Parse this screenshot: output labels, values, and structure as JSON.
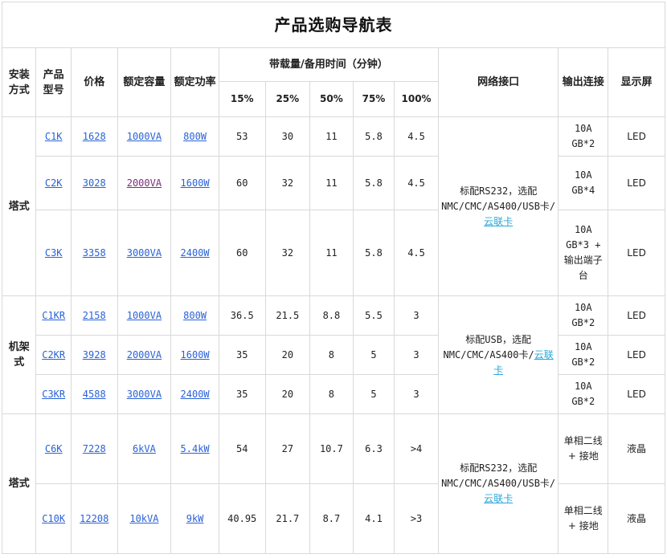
{
  "title": "产品选购导航表",
  "headers": {
    "install": "安装方式",
    "model": "产品型号",
    "price": "价格",
    "capacity": "额定容量",
    "power": "额定功率",
    "backup": "带载量/备用时间（分钟）",
    "p15": "15%",
    "p25": "25%",
    "p50": "50%",
    "p75": "75%",
    "p100": "100%",
    "network": "网络接口",
    "output": "输出连接",
    "display": "显示屏"
  },
  "groups": [
    {
      "install": "塔式",
      "network_prefix": "标配RS232，选配NMC/CMC/AS400/USB卡/",
      "network_link": "云联卡",
      "rows": [
        {
          "model": "C1K",
          "price": "1628",
          "capacity": "1000VA",
          "power": "800W",
          "t15": "53",
          "t25": "30",
          "t50": "11",
          "t75": "5.8",
          "t100": "4.5",
          "output": "10A GB*2",
          "display": "LED"
        },
        {
          "model": "C2K",
          "price": "3028",
          "capacity": "2000VA",
          "power": "1600W",
          "t15": "60",
          "t25": "32",
          "t50": "11",
          "t75": "5.8",
          "t100": "4.5",
          "output": "10A GB*4",
          "display": "LED"
        },
        {
          "model": "C3K",
          "price": "3358",
          "capacity": "3000VA",
          "power": "2400W",
          "t15": "60",
          "t25": "32",
          "t50": "11",
          "t75": "5.8",
          "t100": "4.5",
          "output": "10A GB*3 + 输出端子台",
          "display": "LED"
        }
      ]
    },
    {
      "install": "机架式",
      "network_prefix": "标配USB，选配NMC/CMC/AS400卡/",
      "network_link": "云联卡",
      "rows": [
        {
          "model": "C1KR",
          "price": "2158",
          "capacity": "1000VA",
          "power": "800W",
          "t15": "36.5",
          "t25": "21.5",
          "t50": "8.8",
          "t75": "5.5",
          "t100": "3",
          "output": "10A GB*2",
          "display": "LED"
        },
        {
          "model": "C2KR",
          "price": "3928",
          "capacity": "2000VA",
          "power": "1600W",
          "t15": "35",
          "t25": "20",
          "t50": "8",
          "t75": "5",
          "t100": "3",
          "output": "10A GB*2",
          "display": "LED"
        },
        {
          "model": "C3KR",
          "price": "4588",
          "capacity": "3000VA",
          "power": "2400W",
          "t15": "35",
          "t25": "20",
          "t50": "8",
          "t75": "5",
          "t100": "3",
          "output": "10A GB*2",
          "display": "LED"
        }
      ]
    },
    {
      "install": "塔式",
      "network_prefix": "标配RS232，选配NMC/CMC/AS400/USB卡/",
      "network_link": "云联卡",
      "rows": [
        {
          "model": "C6K",
          "price": "7228",
          "capacity": "6kVA",
          "power": "5.4kW",
          "t15": "54",
          "t25": "27",
          "t50": "10.7",
          "t75": "6.3",
          "t100": ">4",
          "output": "单相二线 + 接地",
          "display": "液晶"
        },
        {
          "model": "C10K",
          "price": "12208",
          "capacity": "10kVA",
          "power": "9kW",
          "t15": "40.95",
          "t25": "21.7",
          "t50": "8.7",
          "t75": "4.1",
          "t100": ">3",
          "output": "单相二线 + 接地",
          "display": "液晶"
        }
      ]
    }
  ]
}
